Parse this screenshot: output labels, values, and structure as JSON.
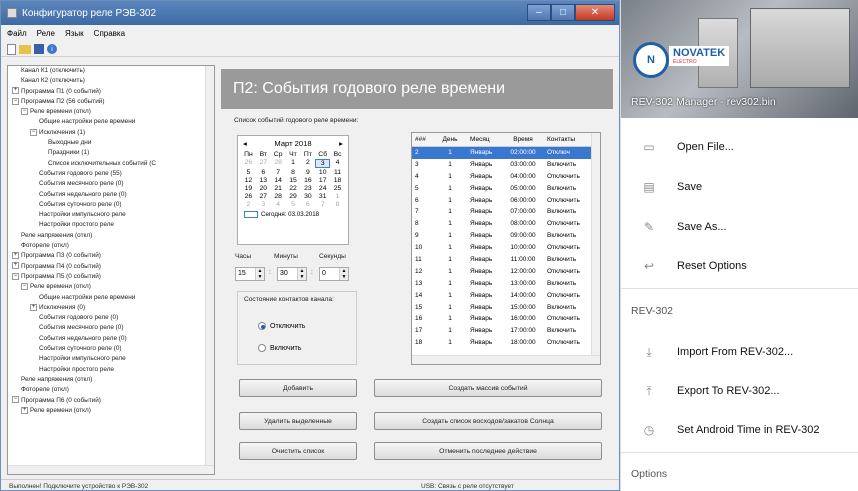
{
  "window": {
    "title": "Конфигуратор реле РЭВ-302",
    "menu": [
      "Файл",
      "Реле",
      "Язык",
      "Справка"
    ]
  },
  "tree": [
    {
      "label": "Канал К1 (отключить)",
      "level": 1,
      "exp": ""
    },
    {
      "label": "Канал К2 (отключить)",
      "level": 1,
      "exp": ""
    },
    {
      "label": "Программа П1 (0 событий)",
      "level": 0,
      "exp": "+"
    },
    {
      "label": "Программа П2 (56 событий)",
      "level": 0,
      "exp": "−"
    },
    {
      "label": "Реле времени (откл)",
      "level": 1,
      "exp": "−"
    },
    {
      "label": "Общие настройки реле времени",
      "level": 3,
      "exp": ""
    },
    {
      "label": "Исключения (1)",
      "level": 2,
      "exp": "−"
    },
    {
      "label": "Выходные дни",
      "level": 4,
      "exp": ""
    },
    {
      "label": "Праздники (1)",
      "level": 4,
      "exp": ""
    },
    {
      "label": "Список исключительных событий (С",
      "level": 4,
      "exp": ""
    },
    {
      "label": "События годового реле (55)",
      "level": 3,
      "exp": ""
    },
    {
      "label": "События месячного реле (0)",
      "level": 3,
      "exp": ""
    },
    {
      "label": "События недельного реле (0)",
      "level": 3,
      "exp": ""
    },
    {
      "label": "События суточного реле (0)",
      "level": 3,
      "exp": ""
    },
    {
      "label": "Настройки импульсного реле",
      "level": 3,
      "exp": ""
    },
    {
      "label": "Настройки простого реле",
      "level": 3,
      "exp": ""
    },
    {
      "label": "Реле напряжения (откл)",
      "level": 1,
      "exp": ""
    },
    {
      "label": "Фотореле (откл)",
      "level": 1,
      "exp": ""
    },
    {
      "label": "Программа П3 (0 событий)",
      "level": 0,
      "exp": "+"
    },
    {
      "label": "Программа П4 (0 событий)",
      "level": 0,
      "exp": "+"
    },
    {
      "label": "Программа П5 (0 событий)",
      "level": 0,
      "exp": "−"
    },
    {
      "label": "Реле времени (откл)",
      "level": 1,
      "exp": "−"
    },
    {
      "label": "Общие настройки реле времени",
      "level": 3,
      "exp": ""
    },
    {
      "label": "Исключения (0)",
      "level": 2,
      "exp": "+"
    },
    {
      "label": "События годового реле (0)",
      "level": 3,
      "exp": ""
    },
    {
      "label": "События месячного реле (0)",
      "level": 3,
      "exp": ""
    },
    {
      "label": "События недельного реле (0)",
      "level": 3,
      "exp": ""
    },
    {
      "label": "События суточного реле (0)",
      "level": 3,
      "exp": ""
    },
    {
      "label": "Настройки импульсного реле",
      "level": 3,
      "exp": ""
    },
    {
      "label": "Настройки простого реле",
      "level": 3,
      "exp": ""
    },
    {
      "label": "Реле напряжения (откл)",
      "level": 1,
      "exp": ""
    },
    {
      "label": "Фотореле (откл)",
      "level": 1,
      "exp": ""
    },
    {
      "label": "Программа П6 (0 событий)",
      "level": 0,
      "exp": "−"
    },
    {
      "label": "Реле времени (откл)",
      "level": 1,
      "exp": "+"
    }
  ],
  "main": {
    "header": "П2:  События годового реле времени",
    "events_list_label": "Список событий годового реле времени:",
    "calendar": {
      "month": "Март 2018",
      "weekdays": [
        "Пн",
        "Вт",
        "Ср",
        "Чт",
        "Пт",
        "Сб",
        "Вс"
      ],
      "days": [
        {
          "d": "26",
          "dim": true
        },
        {
          "d": "27",
          "dim": true
        },
        {
          "d": "28",
          "dim": true
        },
        {
          "d": "1"
        },
        {
          "d": "2"
        },
        {
          "d": "3",
          "sel": true
        },
        {
          "d": "4"
        },
        {
          "d": "5"
        },
        {
          "d": "6"
        },
        {
          "d": "7"
        },
        {
          "d": "8"
        },
        {
          "d": "9"
        },
        {
          "d": "10"
        },
        {
          "d": "11"
        },
        {
          "d": "12"
        },
        {
          "d": "13"
        },
        {
          "d": "14"
        },
        {
          "d": "15"
        },
        {
          "d": "16"
        },
        {
          "d": "17"
        },
        {
          "d": "18"
        },
        {
          "d": "19"
        },
        {
          "d": "20"
        },
        {
          "d": "21"
        },
        {
          "d": "22"
        },
        {
          "d": "23"
        },
        {
          "d": "24"
        },
        {
          "d": "25"
        },
        {
          "d": "26"
        },
        {
          "d": "27"
        },
        {
          "d": "28"
        },
        {
          "d": "29"
        },
        {
          "d": "30"
        },
        {
          "d": "31"
        },
        {
          "d": "1",
          "dim": true
        },
        {
          "d": "2",
          "dim": true
        },
        {
          "d": "3",
          "dim": true
        },
        {
          "d": "4",
          "dim": true
        },
        {
          "d": "5",
          "dim": true
        },
        {
          "d": "6",
          "dim": true
        },
        {
          "d": "7",
          "dim": true
        },
        {
          "d": "8",
          "dim": true
        }
      ],
      "today": "Сегодня: 03.03.2018"
    },
    "time_labels": {
      "hours": "Часы",
      "minutes": "Минуты",
      "seconds": "Секунды"
    },
    "time_values": {
      "hours": "15",
      "minutes": "30",
      "seconds": "0"
    },
    "contacts_group": "Состояние контактов канала:",
    "radio_off": "Отключить",
    "radio_on": "Включить",
    "table": {
      "headers": [
        "###",
        "День",
        "Месяц",
        "Время",
        "Контакты"
      ],
      "rows": [
        [
          "2",
          "1",
          "Январь",
          "02:00:00",
          "Отключ"
        ],
        [
          "3",
          "1",
          "Январь",
          "03:00:00",
          "Включить"
        ],
        [
          "4",
          "1",
          "Январь",
          "04:00:00",
          "Отключить"
        ],
        [
          "5",
          "1",
          "Январь",
          "05:00:00",
          "Включить"
        ],
        [
          "6",
          "1",
          "Январь",
          "06:00:00",
          "Отключить"
        ],
        [
          "7",
          "1",
          "Январь",
          "07:00:00",
          "Включить"
        ],
        [
          "8",
          "1",
          "Январь",
          "08:00:00",
          "Отключить"
        ],
        [
          "9",
          "1",
          "Январь",
          "09:00:00",
          "Включить"
        ],
        [
          "10",
          "1",
          "Январь",
          "10:00:00",
          "Отключить"
        ],
        [
          "11",
          "1",
          "Январь",
          "11:00:00",
          "Включить"
        ],
        [
          "12",
          "1",
          "Январь",
          "12:00:00",
          "Отключить"
        ],
        [
          "13",
          "1",
          "Январь",
          "13:00:00",
          "Включить"
        ],
        [
          "14",
          "1",
          "Январь",
          "14:00:00",
          "Отключить"
        ],
        [
          "15",
          "1",
          "Январь",
          "15:00:00",
          "Включить"
        ],
        [
          "16",
          "1",
          "Январь",
          "16:00:00",
          "Отключить"
        ],
        [
          "17",
          "1",
          "Январь",
          "17:00:00",
          "Включить"
        ],
        [
          "18",
          "1",
          "Январь",
          "18:00:00",
          "Отключить"
        ]
      ]
    },
    "buttons": {
      "add": "Добавить",
      "mass": "Создать массив событий",
      "delete_selected": "Удалить выделенные",
      "sunrise": "Создать список восходов/закатов Солнца",
      "clear": "Очистить список",
      "undo": "Отменить последнее действие"
    },
    "status_left": "Выполнен! Подключите устройство к РЭВ-302",
    "status_right": "USB: Связь с реле отсутствует"
  },
  "drawer": {
    "brand": "NOVATEK",
    "brand_sub": "ELECTRO",
    "subtitle": "REV-302 Manager - rev302.bin",
    "items": [
      "Open File...",
      "Save",
      "Save As...",
      "Reset Options"
    ],
    "section_device": "REV-302",
    "device_items": [
      "Import From REV-302...",
      "Export To REV-302...",
      "Set Android Time in REV-302"
    ],
    "section_options": "Options"
  }
}
